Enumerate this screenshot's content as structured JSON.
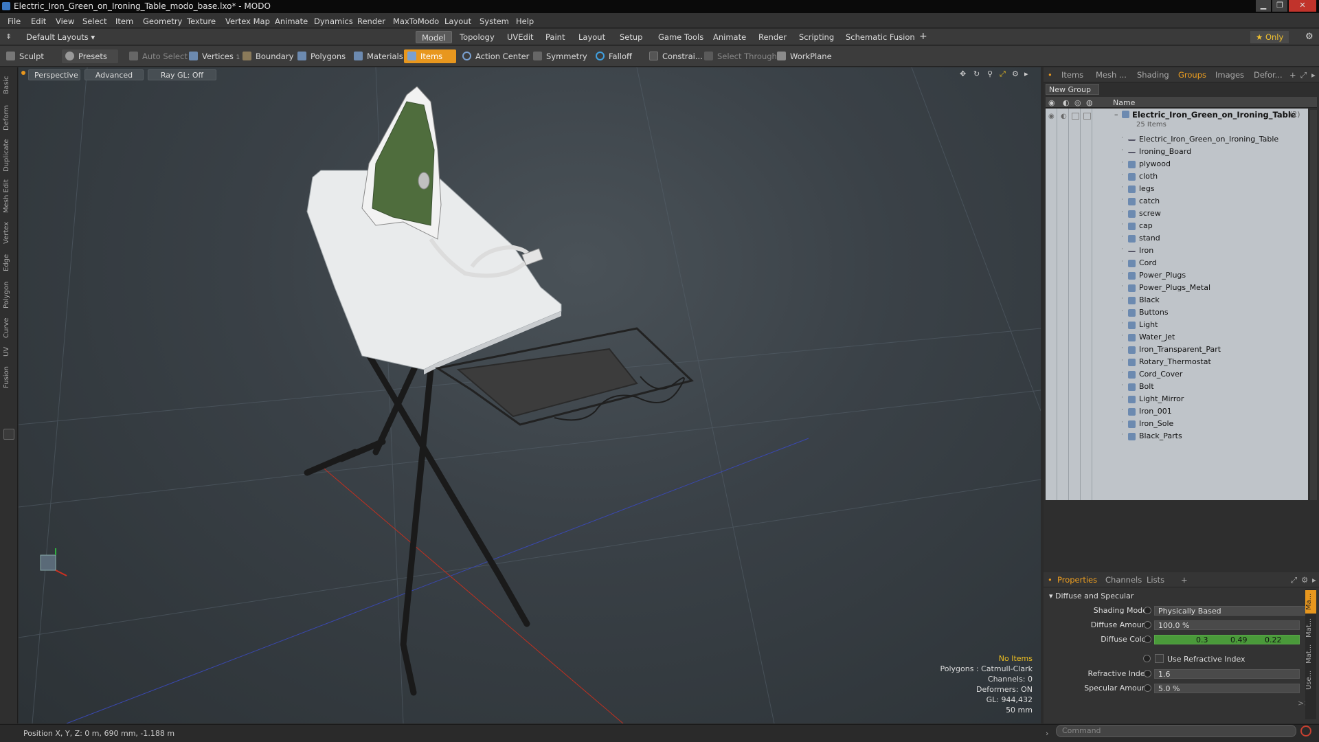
{
  "window": {
    "title": "Electric_Iron_Green_on_Ironing_Table_modo_base.lxo* - MODO",
    "min": "▁",
    "max": "❐",
    "close": "✕"
  },
  "menu": [
    "File",
    "Edit",
    "View",
    "Select",
    "Item",
    "Geometry",
    "Texture",
    "Vertex Map",
    "Animate",
    "Dynamics",
    "Render",
    "MaxToModo",
    "Layout",
    "System",
    "Help"
  ],
  "layoutbar": {
    "layouts_label": "Default Layouts ▾",
    "tabs": [
      "Model",
      "Topology",
      "UVEdit",
      "Paint",
      "Layout",
      "Setup",
      "Game Tools",
      "Animate",
      "Render",
      "Scripting",
      "Schematic Fusion"
    ],
    "add": "+",
    "only_label": "★  Only",
    "gear": "⚙"
  },
  "toolbar": {
    "sculpt": "Sculpt",
    "presets": "Presets",
    "auto_select": "Auto Select",
    "vertices": "Vertices",
    "vertices_count": "1",
    "boundary": "Boundary",
    "polygons": "Polygons",
    "materials": "Materials",
    "items": "Items",
    "action_center": "Action Center",
    "symmetry": "Symmetry",
    "falloff": "Falloff",
    "constrain": "Constrai...",
    "select_through": "Select Through",
    "workplane": "WorkPlane"
  },
  "left_strip": [
    "Basic",
    "Deform",
    "Duplicate",
    "Mesh Edit",
    "Vertex",
    "Edge",
    "Polygon",
    "Curve",
    "UV",
    "Fusion"
  ],
  "viewport": {
    "view_mode": "Perspective",
    "advanced": "Advanced",
    "raygl": "Ray GL: Off",
    "info": {
      "items": "No Items",
      "polygons": "Polygons : Catmull-Clark",
      "channels": "Channels: 0",
      "deformers": "Deformers: ON",
      "gl": "GL: 944,432",
      "scale": "50 mm"
    }
  },
  "panel_tabs": [
    "Items",
    "Mesh ...",
    "Shading",
    "Groups",
    "Images",
    "Defor..."
  ],
  "panel_tab_add": "+",
  "groups": {
    "new_group": "New Group",
    "name_header": "Name",
    "root": "Electric_Iron_Green_on_Ironing_Table",
    "root_count": "(2)",
    "root_sub": "25 Items",
    "items": [
      "Electric_Iron_Green_on_Ironing_Table",
      "Ironing_Board",
      "plywood",
      "cloth",
      "legs",
      "catch",
      "screw",
      "cap",
      "stand",
      "Iron",
      "Cord",
      "Power_Plugs",
      "Power_Plugs_Metal",
      "Black",
      "Buttons",
      "Light",
      "Water_Jet",
      "Iron_Transparent_Part",
      "Rotary_Thermostat",
      "Cord_Cover",
      "Bolt",
      "Light_Mirror",
      "Iron_001",
      "Iron_Sole",
      "Black_Parts"
    ],
    "locator_items": [
      0,
      1,
      9
    ]
  },
  "properties": {
    "tabs": [
      "Properties",
      "Channels",
      "Lists"
    ],
    "section": "Diffuse and Specular",
    "shading_model_label": "Shading Model",
    "shading_model": "Physically Based",
    "diffuse_amount_label": "Diffuse Amount",
    "diffuse_amount": "100.0 %",
    "diffuse_color_label": "Diffuse Color",
    "diffuse_color": [
      "0.3",
      "0.49",
      "0.22"
    ],
    "use_refractive_label": "Use Refractive Index",
    "refractive_index_label": "Refractive Index",
    "refractive_index": "1.6",
    "specular_amount_label": "Specular Amount",
    "specular_amount": "5.0 %",
    "side_tabs": [
      "Ma...",
      "Mat...",
      "Mat...",
      "Use..."
    ],
    "more": ">>"
  },
  "status": {
    "position": "Position X, Y, Z:  0 m, 690 mm, -1.188 m",
    "command_placeholder": "Command"
  },
  "colors": {
    "accent": "#e8971e",
    "diffuse_swatch": "#4a9a3a"
  }
}
